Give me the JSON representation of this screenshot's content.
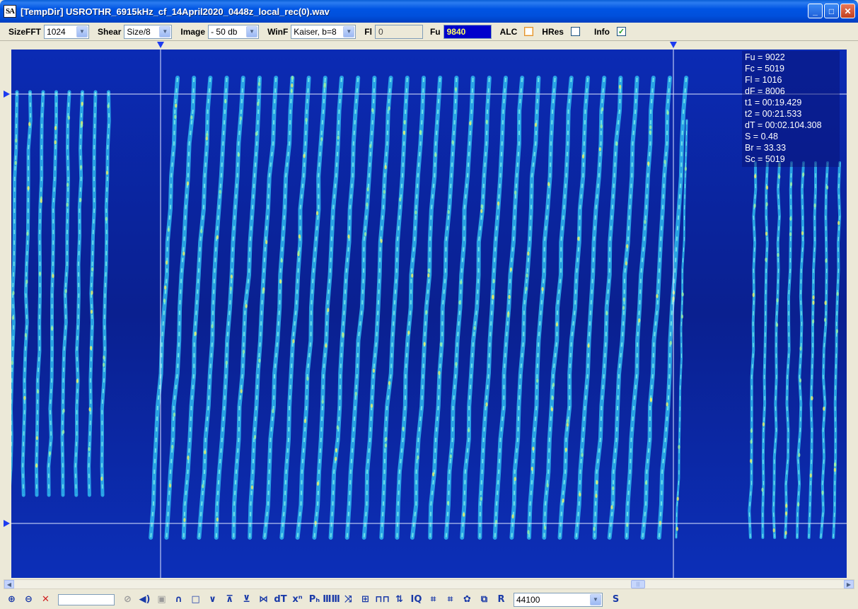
{
  "window": {
    "app_icon": "SA",
    "title": "[TempDir] USROTHR_6915kHz_cf_14April2020_0448z_local_rec(0).wav",
    "buttons": {
      "minimize": "_",
      "maximize": "□",
      "close": "✕"
    }
  },
  "toolbar": {
    "size_fft_label": "SizeFFT",
    "size_fft_value": "1024",
    "shear_label": "Shear",
    "shear_value": "Size/8",
    "image_label": "Image",
    "image_value": "- 50 db",
    "winf_label": "WinF",
    "winf_value": "Kaiser, b=8",
    "fl_label": "Fl",
    "fl_value": "0",
    "fu_label": "Fu",
    "fu_value": "9840",
    "alc_label": "ALC",
    "alc_checked": false,
    "hres_label": "HRes",
    "hres_checked": false,
    "info_label": "Info",
    "info_checked": true,
    "check_mark": "✓"
  },
  "info_panel": {
    "lines": [
      "Fu = 9022",
      "Fc = 5019",
      "Fl = 1016",
      "dF = 8006",
      "t1 = 00:19.429",
      "t2 = 00:21.533",
      "dT = 00:02.104.308",
      "S = 0.48",
      "Br = 33.33",
      "Sc = 5019"
    ]
  },
  "scrollbar": {
    "left_arrow": "◀",
    "right_arrow": "▶",
    "thumb_grip": "|||"
  },
  "bottom_toolbar": {
    "icons": [
      {
        "name": "zoom-in-icon",
        "glyph": "⊕",
        "color": "blue"
      },
      {
        "name": "zoom-out-icon",
        "glyph": "⊖",
        "color": "blue"
      },
      {
        "name": "zoom-reset-icon",
        "glyph": "✕",
        "color": "red"
      }
    ],
    "icons2": [
      {
        "name": "stop-icon",
        "glyph": "⊘",
        "color": "gray"
      },
      {
        "name": "speaker-icon",
        "glyph": "◀)",
        "color": "blue"
      },
      {
        "name": "square-icon",
        "glyph": "▣",
        "color": "gray"
      },
      {
        "name": "arc-icon",
        "glyph": "∩",
        "color": "blue"
      },
      {
        "name": "rectangle-icon",
        "glyph": "□",
        "color": "blue"
      },
      {
        "name": "valley-icon",
        "glyph": "∨",
        "color": "blue"
      },
      {
        "name": "split-icon",
        "glyph": "⊼",
        "color": "blue"
      },
      {
        "name": "converge-icon",
        "glyph": "⊻",
        "color": "blue"
      },
      {
        "name": "expand-icon",
        "glyph": "⋈",
        "color": "blue"
      },
      {
        "name": "dt-icon",
        "glyph": "dT",
        "color": "blue"
      },
      {
        "name": "x-power-icon",
        "glyph": "xⁿ",
        "color": "blue"
      },
      {
        "name": "ph-icon",
        "glyph": "Pₕ",
        "color": "blue"
      },
      {
        "name": "comb-icon",
        "glyph": "ⅢⅢ",
        "color": "blue"
      },
      {
        "name": "cross-icon",
        "glyph": "⤨",
        "color": "blue"
      },
      {
        "name": "grid-icon",
        "glyph": "⊞",
        "color": "blue"
      },
      {
        "name": "pulse-icon",
        "glyph": "⊓⊓",
        "color": "blue"
      },
      {
        "name": "updown-icon",
        "glyph": "⇅",
        "color": "blue"
      },
      {
        "name": "iq-icon",
        "glyph": "IQ",
        "color": "blue"
      },
      {
        "name": "pattern-a-icon",
        "glyph": "⌗",
        "color": "blue"
      },
      {
        "name": "pattern-b-icon",
        "glyph": "⌗",
        "color": "blue"
      },
      {
        "name": "gear-icon",
        "glyph": "✿",
        "color": "blue"
      },
      {
        "name": "copy-icon",
        "glyph": "⧉",
        "color": "blue"
      },
      {
        "name": "r-icon",
        "glyph": "R",
        "color": "blue"
      }
    ],
    "sample_rate": "44100",
    "s_button": "S"
  }
}
